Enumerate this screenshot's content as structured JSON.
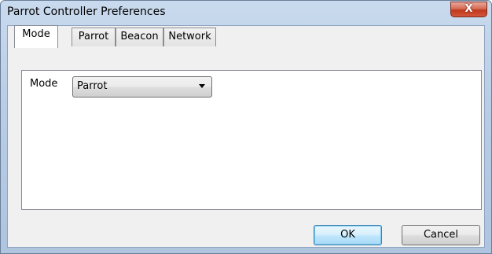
{
  "window": {
    "title": "Parrot Controller Preferences",
    "close_glyph": "X"
  },
  "tabs": [
    {
      "label": "Mode",
      "active": true
    },
    {
      "label": "Parrot",
      "active": false
    },
    {
      "label": "Beacon",
      "active": false
    },
    {
      "label": "Network",
      "active": false
    }
  ],
  "mode_panel": {
    "label": "Mode",
    "selected_value": "Parrot"
  },
  "buttons": {
    "ok": "OK",
    "cancel": "Cancel"
  },
  "colors": {
    "frame": "#b9cde6",
    "close_button": "#c0391e",
    "default_button": "#bee6fd"
  }
}
